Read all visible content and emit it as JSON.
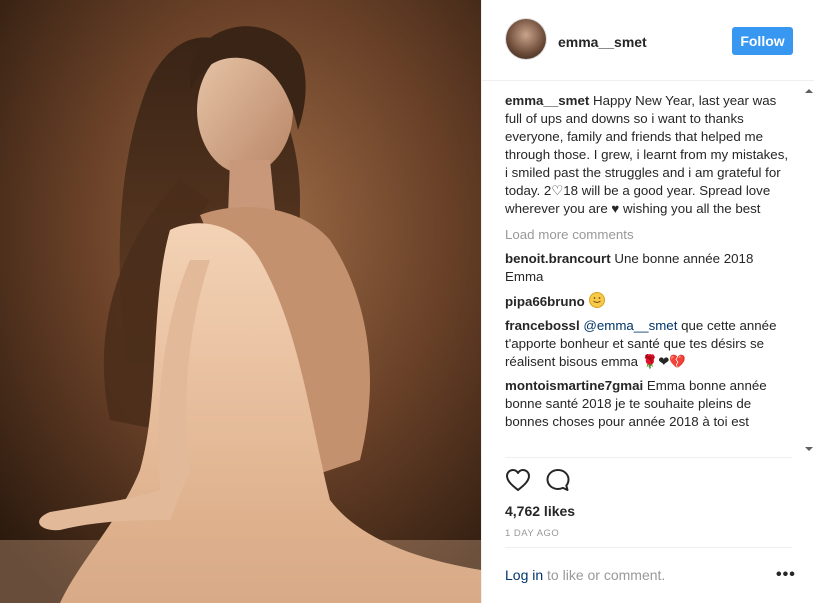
{
  "post_image": {
    "alt": "photo"
  },
  "header": {
    "username": "emma__smet",
    "follow_label": "Follow"
  },
  "caption": {
    "author": "emma__smet",
    "text": "Happy New Year, last year was full of ups and downs so i want to thanks everyone, family and friends that helped me through those. I grew, i learnt from my mistakes, i smiled past the struggles and i am grateful for today. 2♡18 will be a good year. Spread love wherever you are ♥ wishing you all the best"
  },
  "load_more_label": "Load more comments",
  "comments": [
    {
      "author": "benoit.brancourt",
      "text": "Une bonne année 2018 Emma"
    },
    {
      "author": "pipa66bruno",
      "text": ""
    },
    {
      "author": "francebossl",
      "mention": "@emma__smet",
      "text": "que cette année t'apporte bonheur et santé que tes désirs se réalisent bisous emma 🌹❤💔"
    },
    {
      "author": "montoismartine7gmai",
      "text": "Emma bonne année bonne santé 2018 je te souhaite pleins de bonnes choses pour année 2018 à toi est"
    }
  ],
  "likes": "4,762 likes",
  "time_ago": "1 DAY AGO",
  "footer": {
    "login_label": "Log in",
    "login_suffix": " to like or comment.",
    "more_label": "•••"
  },
  "colors": {
    "follow_button": "#3897f0",
    "link": "#003569",
    "muted": "#999999"
  },
  "icons": [
    "heart-icon",
    "comment-icon",
    "more-options-icon",
    "scroll-up-icon",
    "scroll-down-icon",
    "smile-emoji-icon"
  ]
}
